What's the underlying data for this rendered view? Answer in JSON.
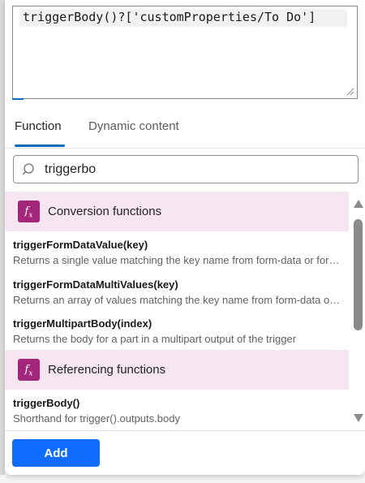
{
  "editor": {
    "expression": "triggerBody()?['customProperties/To Do']"
  },
  "tabs": [
    {
      "label": "Function",
      "active": true
    },
    {
      "label": "Dynamic content",
      "active": false
    }
  ],
  "search": {
    "value": "triggerbo",
    "icon": "search-icon"
  },
  "groups": [
    {
      "title": "Conversion functions",
      "icon": "fx-icon",
      "items": [
        {
          "name": "triggerFormDataValue(key)",
          "description": "Returns a single value matching the key name from form-data or form-encoded trigger output"
        },
        {
          "name": "triggerFormDataMultiValues(key)",
          "description": "Returns an array of values matching the key name from form-data or form-encoded trigger output"
        },
        {
          "name": "triggerMultipartBody(index)",
          "description": "Returns the body for a part in a multipart output of the trigger"
        }
      ]
    },
    {
      "title": "Referencing functions",
      "icon": "fx-icon",
      "items": [
        {
          "name": "triggerBody()",
          "description": "Shorthand for trigger().outputs.body"
        }
      ]
    }
  ],
  "footer": {
    "add_label": "Add"
  },
  "colors": {
    "accent": "#0f6cbd",
    "add_button": "#0f6cfd",
    "group_header_bg": "#f5e6f2",
    "fx_badge": "#a4267a"
  }
}
